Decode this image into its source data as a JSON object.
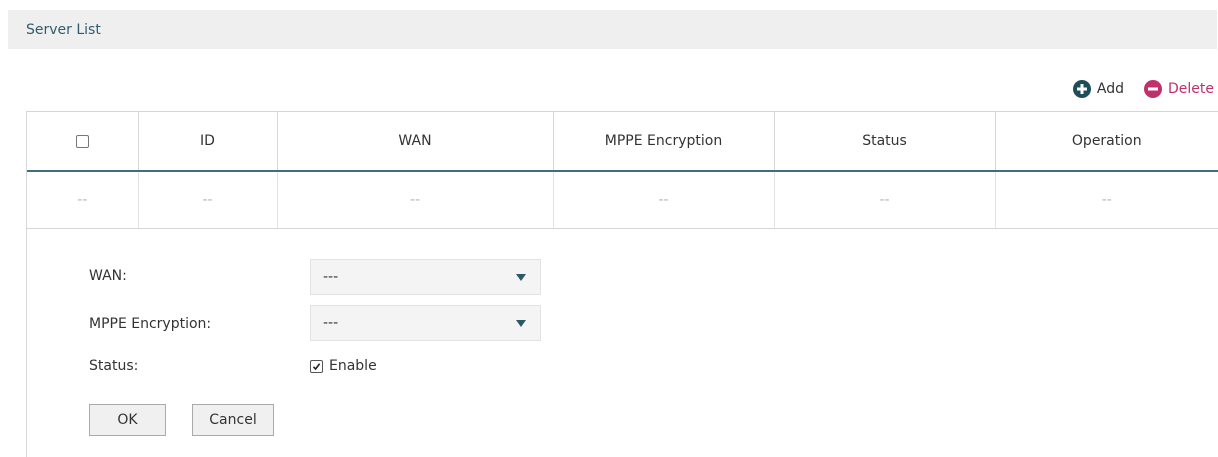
{
  "section": {
    "title": "Server List"
  },
  "toolbar": {
    "add_label": "Add",
    "delete_label": "Delete"
  },
  "table": {
    "headers": [
      "ID",
      "WAN",
      "MPPE Encryption",
      "Status",
      "Operation"
    ],
    "rows": [
      [
        "--",
        "--",
        "--",
        "--",
        "--",
        "--"
      ]
    ]
  },
  "form": {
    "wan_label": "WAN:",
    "wan_value": "---",
    "mppe_label": "MPPE Encryption:",
    "mppe_value": "---",
    "status_label": "Status:",
    "status_checkbox_label": "Enable",
    "status_checked": true,
    "ok_label": "OK",
    "cancel_label": "Cancel"
  },
  "colors": {
    "header_text": "#2f5d6e",
    "delete_accent": "#c0306d",
    "add_icon": "#1f4e5a",
    "table_rule": "#3f6f7a"
  },
  "icons": {
    "add": "plus-circle-icon",
    "delete": "minus-circle-icon",
    "dropdown": "caret-down-icon",
    "check": "checkmark-icon"
  }
}
